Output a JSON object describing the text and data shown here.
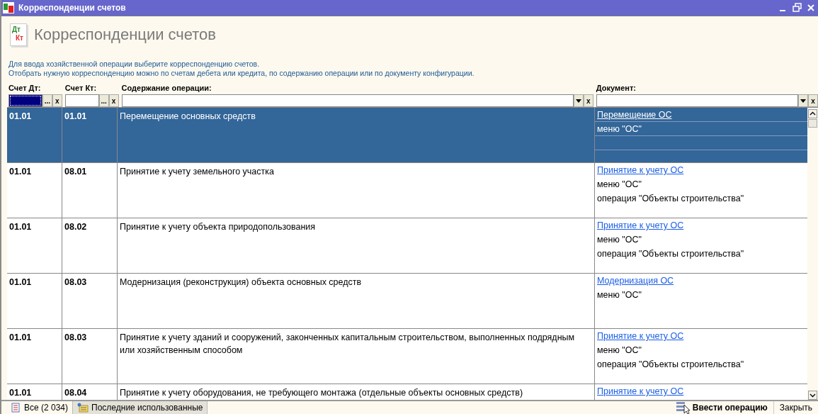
{
  "window": {
    "title": "Корреспонденции счетов"
  },
  "header": {
    "icon_labels": [
      "Дт",
      "Кт"
    ],
    "title": "Корреспонденции счетов",
    "description": [
      "Для ввода хозяйственной операции выберите корреспонденцию счетов.",
      "Отобрать нужную корреспонденцию можно по счетам дебета или кредита, по содержанию операции или по документу конфигурации."
    ]
  },
  "filters": [
    {
      "label": "Счет Дт:",
      "kind": "account",
      "focused": true,
      "choose_button": "...",
      "clear_button": "x"
    },
    {
      "label": "Счет Кт:",
      "kind": "account",
      "focused": false,
      "choose_button": "...",
      "clear_button": "x"
    },
    {
      "label": "Содержание операции:",
      "kind": "dropdown",
      "focused": false,
      "clear_button": "x"
    },
    {
      "label": "Документ:",
      "kind": "dropdown",
      "focused": false,
      "clear_button": "x"
    }
  ],
  "rows": [
    {
      "debit": "01.01",
      "credit": "01.01",
      "content": "Перемещение основных средств",
      "document": {
        "link": "Перемещение ОС",
        "lines": [
          "меню \"ОС\""
        ]
      },
      "selected": true
    },
    {
      "debit": "01.01",
      "credit": "08.01",
      "content": "Принятие к учету земельного участка",
      "document": {
        "link": "Принятие к учету ОС",
        "lines": [
          "меню \"ОС\"",
          "операция \"Объекты строительства\""
        ]
      },
      "selected": false
    },
    {
      "debit": "01.01",
      "credit": "08.02",
      "content": "Принятие к учету объекта природопользования",
      "document": {
        "link": "Принятие к учету ОС",
        "lines": [
          "меню \"ОС\"",
          "операция \"Объекты строительства\""
        ]
      },
      "selected": false
    },
    {
      "debit": "01.01",
      "credit": "08.03",
      "content": "Модернизация (реконструкция) объекта основных средств",
      "document": {
        "link": "Модернизация ОС",
        "lines": [
          "меню \"ОС\""
        ]
      },
      "selected": false
    },
    {
      "debit": "01.01",
      "credit": "08.03",
      "content": "Принятие к учету зданий и сооружений, законченных капитальным строительством, выполненных подрядным или хозяйственным способом",
      "document": {
        "link": "Принятие к учету ОС",
        "lines": [
          "меню \"ОС\"",
          "операция \"Объекты строительства\""
        ]
      },
      "selected": false
    },
    {
      "debit": "01.01",
      "credit": "08.04",
      "content": "Принятие к учету оборудования, не требующего монтажа (отдельные объекты основных средств)",
      "document": {
        "link": "Принятие к учету ОС"
      },
      "selected": false
    }
  ],
  "tabs": [
    {
      "label": "Все (2 034)",
      "selected": true
    },
    {
      "label": "Последние использованные",
      "selected": false
    }
  ],
  "buttons": [
    {
      "label": "Ввести операцию",
      "kind": "primary"
    },
    {
      "label": "Закрыть",
      "kind": "plain"
    }
  ]
}
